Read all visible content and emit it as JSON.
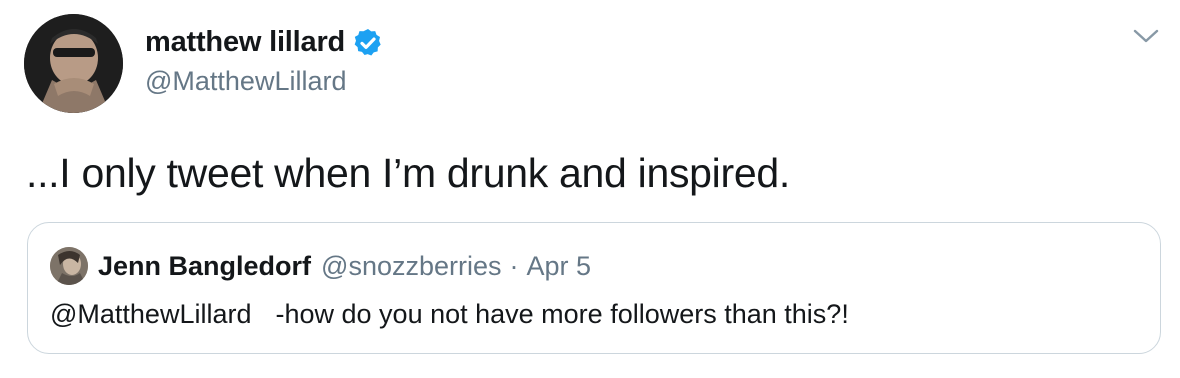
{
  "tweet": {
    "author": {
      "display_name": "matthew lillard",
      "handle": "@MatthewLillard",
      "verified": true
    },
    "text": "...I only tweet when I’m drunk and inspired.",
    "quoted": {
      "display_name": "Jenn Bangledorf",
      "handle": "@snozzberries",
      "separator": "·",
      "date": "Apr 5",
      "mention": "@MatthewLillard",
      "text": "-how do you not have more followers than this?!"
    }
  },
  "icons": {
    "verified": "verified-badge-icon",
    "menu": "chevron-down-icon"
  },
  "colors": {
    "primary_text": "#14171a",
    "secondary_text": "#657786",
    "verified_blue": "#1da1f2",
    "border": "#ccd6dd"
  }
}
